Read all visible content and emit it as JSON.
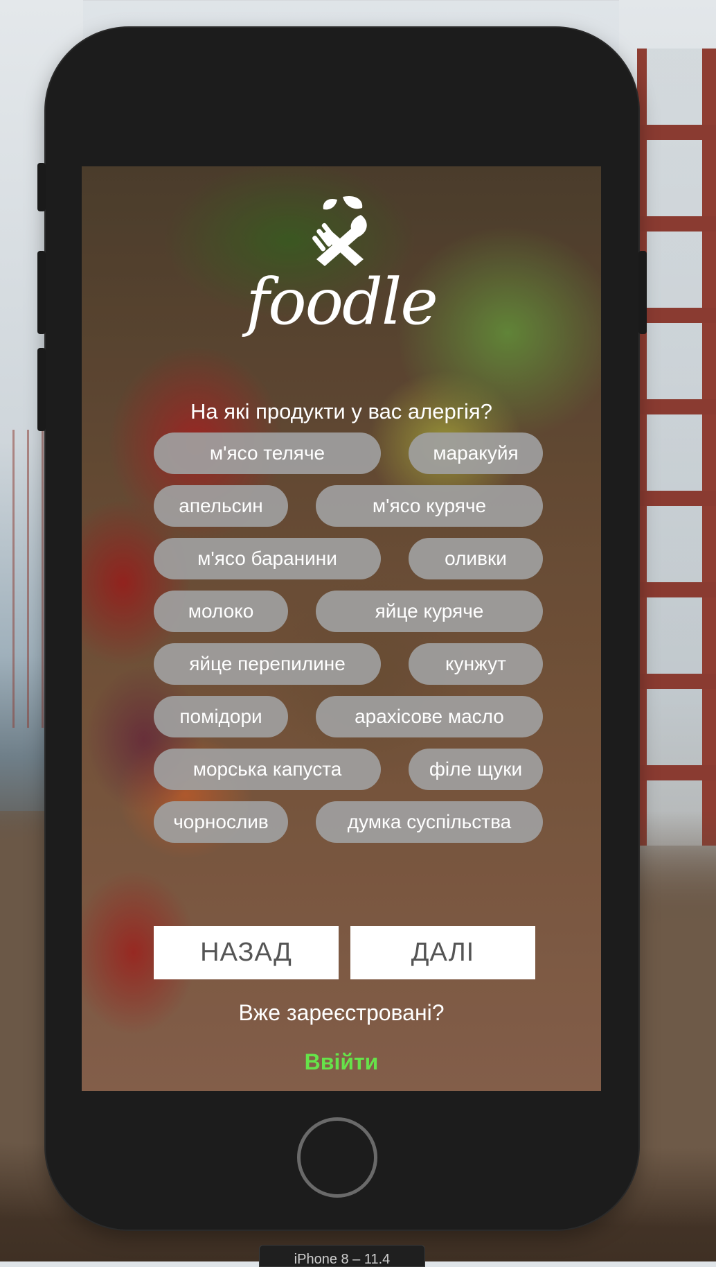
{
  "app": {
    "brand": "foodle",
    "question": "На які продукти у вас алергія?"
  },
  "allergens": [
    "м'ясо теляче",
    "маракуйя",
    "апельсин",
    "м'ясо куряче",
    "м'ясо баранини",
    "оливки",
    "молоко",
    "яйце куряче",
    "яйце перепилине",
    "кунжут",
    "помідори",
    "арахісове масло",
    "морська капуста",
    "філе щуки",
    "чорнослив",
    "думка суспільства"
  ],
  "buttons": {
    "back": "НАЗАД",
    "next": "ДАЛІ"
  },
  "auth": {
    "registered": "Вже зареєстровані?",
    "login": "Ввійти"
  },
  "simulator": {
    "device": "iPhone 8 – 11.4"
  },
  "colors": {
    "login_accent": "#66e34a",
    "chip_bg": "#a0a0a0"
  },
  "icons": {
    "logo": "leaf-fork-knife-icon"
  }
}
